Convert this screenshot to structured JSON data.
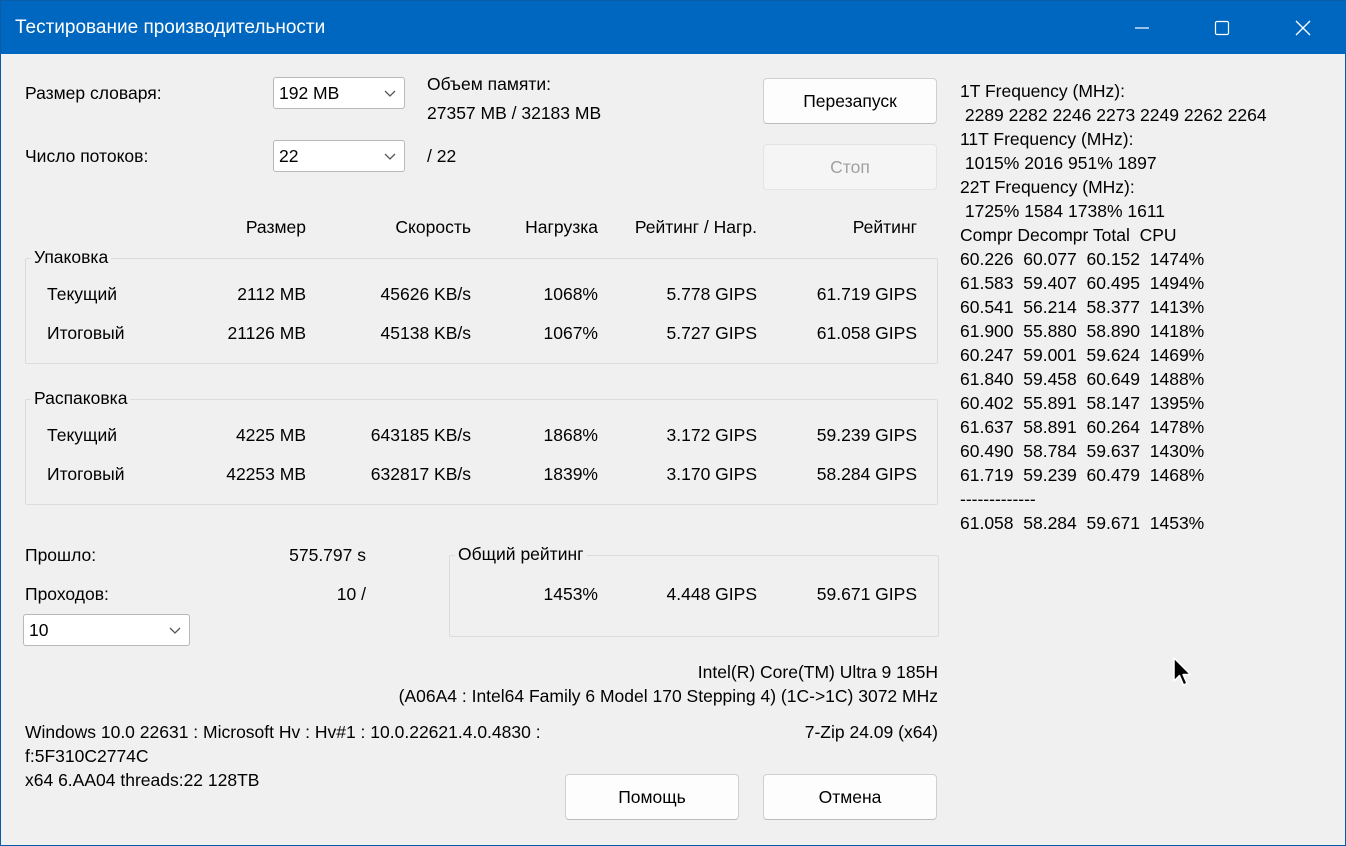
{
  "window": {
    "title": "Тестирование производительности"
  },
  "settings": {
    "dict_label": "Размер словаря:",
    "dict_value": "192 MB",
    "threads_label": "Число потоков:",
    "threads_value": "22",
    "threads_max": "/ 22",
    "memory_label": "Объем памяти:",
    "memory_value": "27357 MB / 32183 MB"
  },
  "buttons": {
    "restart": "Перезапуск",
    "stop": "Стоп",
    "help": "Помощь",
    "cancel": "Отмена"
  },
  "table": {
    "headers": [
      "Размер",
      "Скорость",
      "Нагрузка",
      "Рейтинг / Нагр.",
      "Рейтинг"
    ],
    "packing": {
      "title": "Упаковка",
      "rows": [
        {
          "label": "Текущий",
          "size": "2112 MB",
          "speed": "45626 KB/s",
          "load": "1068%",
          "rating_load": "5.778 GIPS",
          "rating": "61.719 GIPS"
        },
        {
          "label": "Итоговый",
          "size": "21126 MB",
          "speed": "45138 KB/s",
          "load": "1067%",
          "rating_load": "5.727 GIPS",
          "rating": "61.058 GIPS"
        }
      ]
    },
    "unpacking": {
      "title": "Распаковка",
      "rows": [
        {
          "label": "Текущий",
          "size": "4225 MB",
          "speed": "643185 KB/s",
          "load": "1868%",
          "rating_load": "3.172 GIPS",
          "rating": "59.239 GIPS"
        },
        {
          "label": "Итоговый",
          "size": "42253 MB",
          "speed": "632817 KB/s",
          "load": "1839%",
          "rating_load": "3.170 GIPS",
          "rating": "58.284 GIPS"
        }
      ]
    }
  },
  "stats": {
    "elapsed_label": "Прошло:",
    "elapsed_value": "575.797 s",
    "passes_label": "Проходов:",
    "passes_value": "10 /",
    "passes_select": "10"
  },
  "overall": {
    "title": "Общий рейтинг",
    "load": "1453%",
    "rating_load": "4.448 GIPS",
    "rating": "59.671 GIPS"
  },
  "cpu": {
    "name": "Intel(R) Core(TM) Ultra 9 185H",
    "details": "(A06A4 : Intel64 Family 6 Model 170 Stepping 4) (1C->1C) 3072 MHz",
    "version": "7-Zip 24.09 (x64)"
  },
  "system": {
    "line1": "Windows 10.0 22631 : Microsoft Hv : Hv#1 : 10.0.22621.4.0.4830 :",
    "line2": "f:5F310C2774C",
    "line3": "x64 6.AA04 threads:22 128TB"
  },
  "log": [
    "1T Frequency (MHz):",
    " 2289 2282 2246 2273 2249 2262 2264",
    "11T Frequency (MHz):",
    " 1015% 2016 951% 1897",
    "22T Frequency (MHz):",
    " 1725% 1584 1738% 1611",
    "Compr Decompr Total  CPU",
    "60.226  60.077  60.152  1474%",
    "61.583  59.407  60.495  1494%",
    "60.541  56.214  58.377  1413%",
    "61.900  55.880  58.890  1418%",
    "60.247  59.001  59.624  1469%",
    "61.840  59.458  60.649  1488%",
    "60.402  55.891  58.147  1395%",
    "61.637  58.891  60.264  1478%",
    "60.490  58.784  59.637  1430%",
    "61.719  59.239  60.479  1468%",
    "-------------",
    "61.058  58.284  59.671  1453%"
  ]
}
